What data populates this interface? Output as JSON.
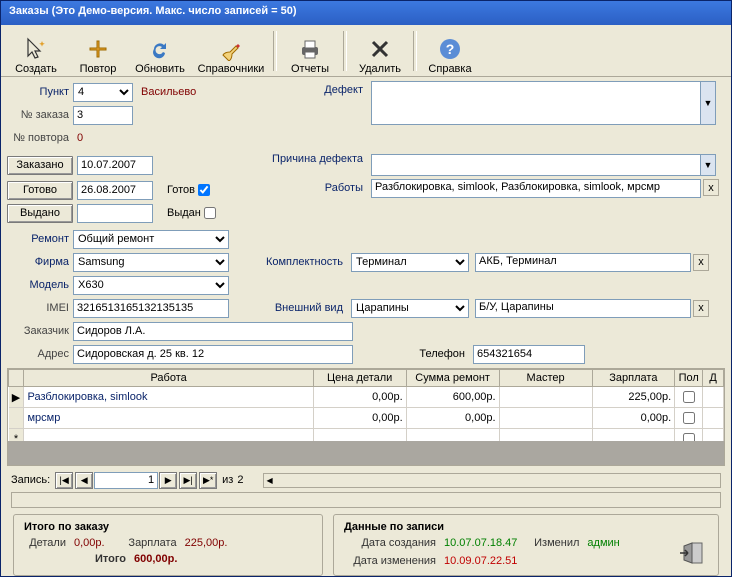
{
  "title": "Заказы  (Это Демо-версия. Макс. число записей = 50)",
  "toolbar": {
    "create": "Создать",
    "repeat": "Повтор",
    "refresh": "Обновить",
    "dicts": "Справочники",
    "reports": "Отчеты",
    "delete": "Удалить",
    "help": "Справка"
  },
  "form": {
    "punkt_lbl": "Пункт",
    "punkt_val": "4",
    "punkt_text": "Васильево",
    "order_no_lbl": "№ заказа",
    "order_no_val": "3",
    "rep_no_lbl": "№ повтора",
    "rep_no_val": "0",
    "defect_lbl": "Дефект",
    "cause_lbl": "Причина дефекта",
    "works_lbl": "Работы",
    "works_val": "Разблокировка, simlook, Разблокировка, simlook, мрсмр",
    "ordered_btn": "Заказано",
    "ordered_val": "10.07.2007",
    "ready_btn": "Готово",
    "ready_val": "26.08.2007",
    "issued_btn": "Выдано",
    "ready_cb": "Готов",
    "issued_cb": "Выдан",
    "repair_lbl": "Ремонт",
    "repair_val": "Общий ремонт",
    "firm_lbl": "Фирма",
    "firm_val": "Samsung",
    "model_lbl": "Модель",
    "model_val": "X630",
    "imei_lbl": "IMEI",
    "imei_val": "3216513165132135135",
    "customer_lbl": "Заказчик",
    "customer_val": "Сидоров Л.А.",
    "address_lbl": "Адрес",
    "address_val": "Сидоровская д. 25 кв. 12",
    "complect_lbl": "Комплектность",
    "complect_sel": "Терминал",
    "complect_val": "АКБ, Терминал",
    "look_lbl": "Внешний вид",
    "look_sel": "Царапины",
    "look_val": "Б/У, Царапины",
    "phone_lbl": "Телефон",
    "phone_val": "654321654"
  },
  "grid": {
    "cols": [
      "Работа",
      "Цена детали",
      "Сумма ремонт",
      "Мастер",
      "Зарплата",
      "Пол",
      "Д"
    ],
    "rows": [
      {
        "work": "Разблокировка, simlook",
        "part": "0,00р.",
        "sum": "600,00р.",
        "master": "",
        "salary": "225,00р.",
        "p": false
      },
      {
        "work": "мрсмр",
        "part": "0,00р.",
        "sum": "0,00р.",
        "master": "",
        "salary": "0,00р.",
        "p": false
      }
    ]
  },
  "nav": {
    "label": "Запись:",
    "pos": "1",
    "of": "из",
    "total": "2"
  },
  "summary": {
    "left_title": "Итого по заказу",
    "detail_lbl": "Детали",
    "detail_val": "0,00р.",
    "salary_lbl": "Зарплата",
    "salary_val": "225,00р.",
    "total_lbl": "Итого",
    "total_val": "600,00р.",
    "right_title": "Данные по записи",
    "created_lbl": "Дата создания",
    "created_val": "10.07.07.18.47",
    "upd_lbl": "Изменил",
    "upd_val": "админ",
    "mod_lbl": "Дата изменения",
    "mod_val": "10.09.07.22.51"
  }
}
